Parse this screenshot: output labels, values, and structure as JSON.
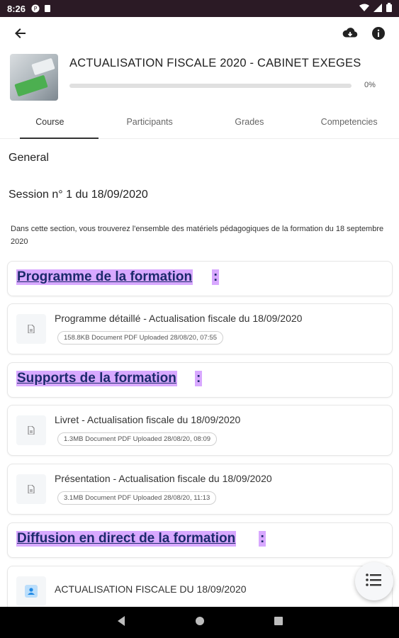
{
  "status_bar": {
    "time": "8:26"
  },
  "app_bar": {
    "back_icon": "arrow-back-icon",
    "download_icon": "cloud-download-icon",
    "info_icon": "info-icon"
  },
  "course": {
    "title": "ACTUALISATION FISCALE 2020 - CABINET EXEGES",
    "progress": 0,
    "progress_label": "0%"
  },
  "tabs": [
    {
      "label": "Course",
      "active": true
    },
    {
      "label": "Participants",
      "active": false
    },
    {
      "label": "Grades",
      "active": false
    },
    {
      "label": "Competencies",
      "active": false
    }
  ],
  "sections": {
    "general": "General",
    "session_title": "Session n° 1 du 18/09/2020",
    "session_summary": "Dans cette section, vous trouverez l'ensemble des matériels pédagogiques de la formation du 18 septembre 2020"
  },
  "labels": {
    "programme": "Programme de la formation",
    "supports": "Supports de la formation",
    "diffusion": "Diffusion en direct de la formation",
    "colon": ":"
  },
  "resources": [
    {
      "name": "Programme détaillé - Actualisation fiscale du 18/09/2020",
      "meta": "158.8KB Document PDF Uploaded 28/08/20, 07:55",
      "icon": "pdf-file-icon"
    },
    {
      "name": "Livret - Actualisation fiscale du 18/09/2020",
      "meta": "1.3MB Document PDF Uploaded 28/08/20, 08:09",
      "icon": "pdf-file-icon"
    },
    {
      "name": "Présentation - Actualisation fiscale du 18/09/2020",
      "meta": "3.1MB Document PDF Uploaded 28/08/20, 11:13",
      "icon": "pdf-file-icon"
    },
    {
      "name": "ACTUALISATION FISCALE DU 18/09/2020",
      "meta": "",
      "icon": "live-session-icon"
    }
  ],
  "fab": {
    "icon": "list-menu-icon"
  },
  "nav_bar": {
    "back": "nav-back-icon",
    "home": "nav-home-icon",
    "recents": "nav-recents-icon"
  }
}
